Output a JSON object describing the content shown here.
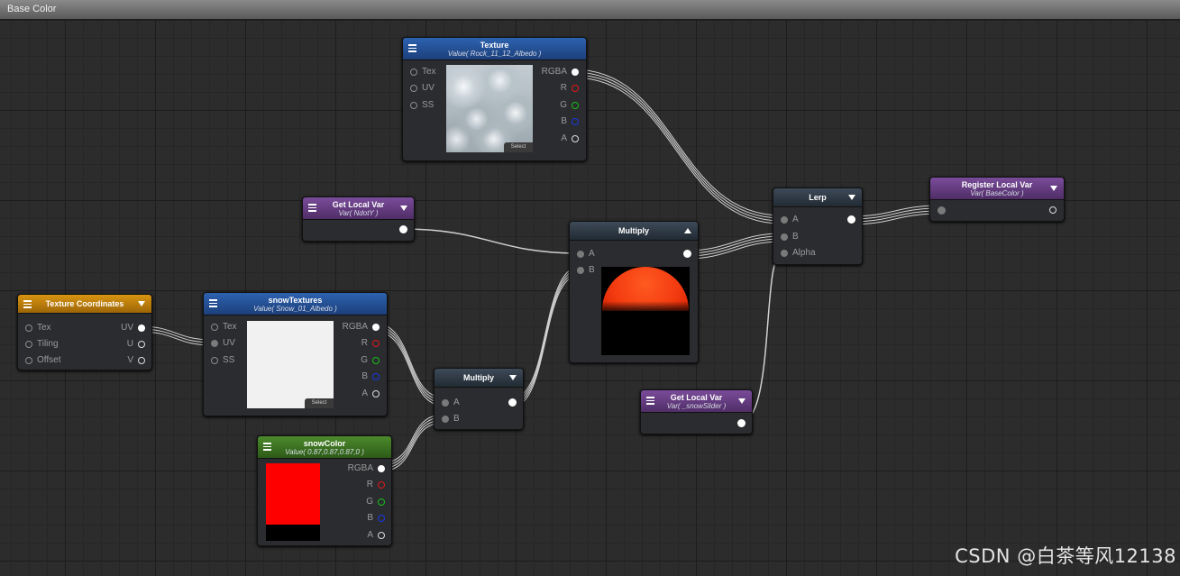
{
  "window": {
    "title": "Base Color"
  },
  "nodes": {
    "texture": {
      "title": "Texture",
      "subtitle": "Value( Rock_11_12_Albedo )",
      "inputs": [
        "Tex",
        "UV",
        "SS"
      ],
      "outputs": [
        "RGBA",
        "R",
        "G",
        "B",
        "A"
      ],
      "select_label": "Select"
    },
    "get_local_var_ndoty": {
      "title": "Get Local Var",
      "subtitle": "Var( NdotY )"
    },
    "multiply_top": {
      "title": "Multiply",
      "inputs": [
        "A",
        "B"
      ]
    },
    "lerp": {
      "title": "Lerp",
      "inputs": [
        "A",
        "B",
        "Alpha"
      ]
    },
    "register_local_var": {
      "title": "Register Local Var",
      "subtitle": "Var( BaseColor )"
    },
    "texture_coordinates": {
      "title": "Texture Coordinates",
      "inputs": [
        "Tex",
        "Tiling",
        "Offset"
      ],
      "outputs": [
        "UV",
        "U",
        "V"
      ]
    },
    "snow_textures": {
      "title": "snowTextures",
      "subtitle": "Value( Snow_01_Albedo )",
      "inputs": [
        "Tex",
        "UV",
        "SS"
      ],
      "outputs": [
        "RGBA",
        "R",
        "G",
        "B",
        "A"
      ],
      "select_label": "Select"
    },
    "multiply_bottom": {
      "title": "Multiply",
      "inputs": [
        "A",
        "B"
      ]
    },
    "get_local_var_snowslider": {
      "title": "Get Local Var",
      "subtitle": "Var( _snowSlider )"
    },
    "snow_color": {
      "title": "snowColor",
      "subtitle": "Value( 0.87,0.87,0.87,0 )",
      "outputs": [
        "RGBA",
        "R",
        "G",
        "B",
        "A"
      ]
    }
  },
  "colors": {
    "header_blue": "#2d62b0",
    "header_purple": "#7a4c9a",
    "header_orange": "#d89410",
    "header_dark": "#3d4a58",
    "header_green": "#4c8a2c",
    "wire": "#d0d0d0",
    "snow_color_swatch": "#ff0000"
  },
  "watermark": "CSDN @白茶等风12138"
}
